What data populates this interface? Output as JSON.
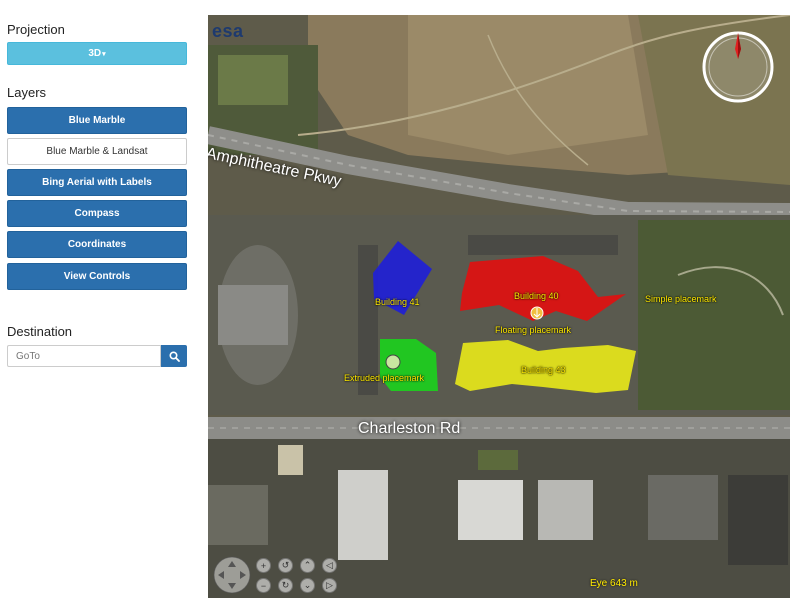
{
  "sidebar": {
    "projection": {
      "title": "Projection",
      "value": "3D"
    },
    "layers": {
      "title": "Layers",
      "items": [
        {
          "label": "Blue Marble",
          "enabled": true
        },
        {
          "label": "Blue Marble & Landsat",
          "enabled": false
        },
        {
          "label": "Bing Aerial with Labels",
          "enabled": true
        },
        {
          "label": "Compass",
          "enabled": true
        },
        {
          "label": "Coordinates",
          "enabled": true
        },
        {
          "label": "View Controls",
          "enabled": true
        }
      ]
    },
    "destination": {
      "title": "Destination",
      "placeholder": "GoTo"
    }
  },
  "map": {
    "logo": "esa",
    "road_labels": [
      "Amphitheatre Pkwy",
      "Charleston Rd"
    ],
    "placemarks": {
      "building41": "Building 41",
      "building40": "Building 40",
      "building43": "Building 43",
      "simple": "Simple placemark",
      "floating": "Floating placemark",
      "extruded": "Extruded placemark"
    },
    "eye": {
      "label": "Eye",
      "value": "643 m"
    },
    "colors": {
      "building41": "#1f1fd6",
      "building40": "#e01010",
      "building43": "#e6e61a",
      "extruded": "#1fcc1f",
      "label": "#ffea00"
    }
  }
}
